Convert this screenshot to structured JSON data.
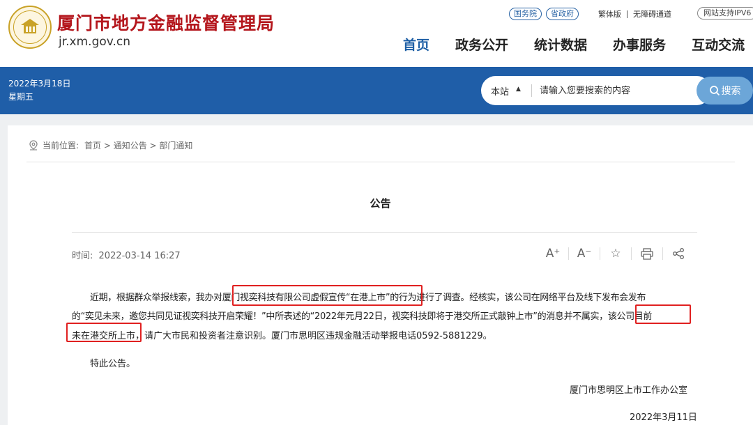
{
  "header": {
    "site_name": "厦门市地方金融监督管理局",
    "domain": "jr.xm.gov.cn",
    "top_links": {
      "guowuyuan": "国务院",
      "shengzhengfu": "省政府",
      "traditional": "繁体版",
      "accessible": "无障碍通道",
      "ipv6": "网站支持IPV6"
    },
    "nav": [
      "首页",
      "政务公开",
      "统计数据",
      "办事服务",
      "互动交流"
    ]
  },
  "band": {
    "date": "2022年3月18日",
    "weekday": "星期五",
    "search": {
      "scope": "本站",
      "placeholder": "请输入您要搜索的内容",
      "button": "搜索"
    }
  },
  "breadcrumb": {
    "label": "当前位置:",
    "path": "首页 > 通知公告 > 部门通知"
  },
  "article": {
    "title": "公告",
    "time_label": "时间:",
    "time": "2022-03-14 16:27",
    "tools": {
      "font_up": "A⁺",
      "font_down": "A⁻",
      "favorite": "☆",
      "print": "⎙",
      "share": "share"
    },
    "lines": [
      "近期，根据群众举报线索，我办对厦门视奕科技有限公司虚假宣传“在港上市”的行为进行了调查。经核实，该公司在网络平台及线下发布会发布",
      "的“奕见未来，邀您共同见证视奕科技开启荣耀！”中所表述的“2022年元月22日，视奕科技即将于港交所正式敲钟上市”的消息并不属实，该公司目前",
      "未在港交所上市，请广大市民和投资者注意识别。厦门市思明区违规金融活动举报电话0592-5881229。"
    ],
    "closing": "特此公告。",
    "signature": "厦门市思明区上市工作办公室",
    "sign_date": "2022年3月11日"
  },
  "colors": {
    "brand_red": "#b4161c",
    "nav_active": "#1d5ea5",
    "band_blue": "#1f5ea8",
    "search_button": "#6ca6d8",
    "highlight_box": "#e02020"
  }
}
